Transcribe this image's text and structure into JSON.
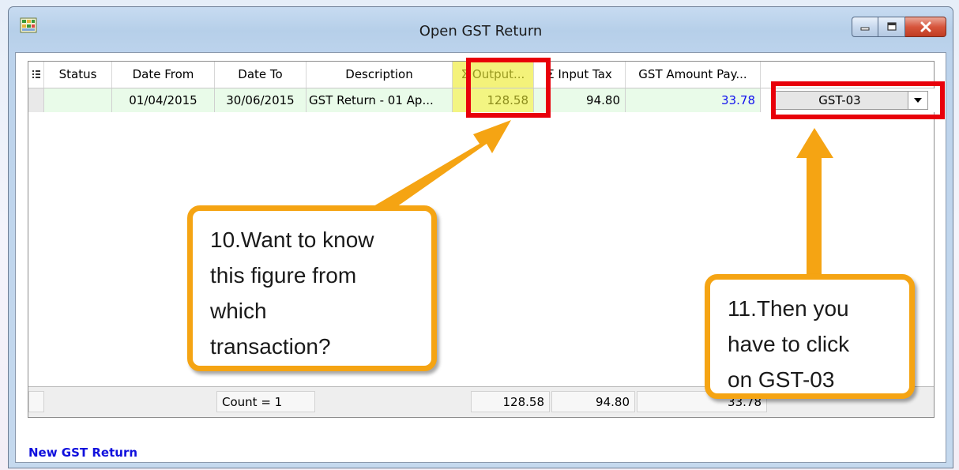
{
  "window": {
    "title": "Open GST Return"
  },
  "grid": {
    "columns": [
      "Status",
      "Date From",
      "Date To",
      "Description",
      "Σ Output...",
      "Σ Input Tax",
      "GST Amount Pay..."
    ],
    "rows": [
      {
        "status": "",
        "date_from": "01/04/2015",
        "date_to": "30/06/2015",
        "description": "GST Return - 01 Ap...",
        "output_tax": "128.58",
        "input_tax": "94.80",
        "gst_payable": "33.78",
        "report": "GST-03"
      }
    ],
    "footer": {
      "count": "Count = 1",
      "output_tax": "128.58",
      "input_tax": "94.80",
      "gst_payable": "33.78"
    }
  },
  "actions": {
    "new_gst_return": "New GST Return"
  },
  "annotations": {
    "step10": "10.Want to know\nthis figure from\nwhich\ntransaction?",
    "step11": "11.Then you\nhave to click\non GST-03"
  },
  "colors": {
    "highlight_red": "#e8000a",
    "callout_orange": "#f5a413",
    "row_green": "#e9fbe9",
    "output_column_yellow": "#f3f582",
    "link_blue": "#1010dd"
  }
}
